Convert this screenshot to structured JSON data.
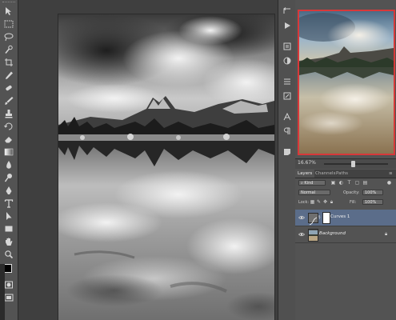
{
  "zoom": "16.67%",
  "panel_tabs": [
    {
      "label": "Layers"
    },
    {
      "label": "Channels"
    },
    {
      "label": "Paths"
    }
  ],
  "filter": {
    "kind_label": "Kind"
  },
  "blend": {
    "mode": "Normal",
    "opacity_label": "Opacity:",
    "opacity_value": "100%"
  },
  "lock": {
    "label": "Lock:",
    "fill_label": "Fill:",
    "fill_value": "100%"
  },
  "layers": [
    {
      "name": "Curves 1",
      "selected": true
    },
    {
      "name": "Background",
      "selected": false
    }
  ],
  "zoom_fraction": 0.45,
  "icons": {
    "tools": [
      "move-tool-icon",
      "marquee-tool-icon",
      "lasso-tool-icon",
      "quick-select-tool-icon",
      "crop-tool-icon",
      "eyedropper-tool-icon",
      "healing-brush-tool-icon",
      "brush-tool-icon",
      "clone-stamp-tool-icon",
      "history-brush-tool-icon",
      "eraser-tool-icon",
      "gradient-tool-icon",
      "blur-tool-icon",
      "dodge-tool-icon",
      "pen-tool-icon",
      "type-tool-icon",
      "path-select-tool-icon",
      "shape-tool-icon",
      "hand-tool-icon",
      "zoom-tool-icon"
    ],
    "dock": [
      "history-panel-icon",
      "actions-panel-icon",
      "properties-panel-icon",
      "adjustments-panel-icon",
      "styles-panel-icon",
      "brush-panel-icon",
      "character-panel-icon",
      "paragraph-panel-icon",
      "notes-panel-icon"
    ]
  },
  "colors": {
    "panel": "#535353",
    "selection": "#5b6d8a",
    "navigator_frame": "#d8383a"
  }
}
